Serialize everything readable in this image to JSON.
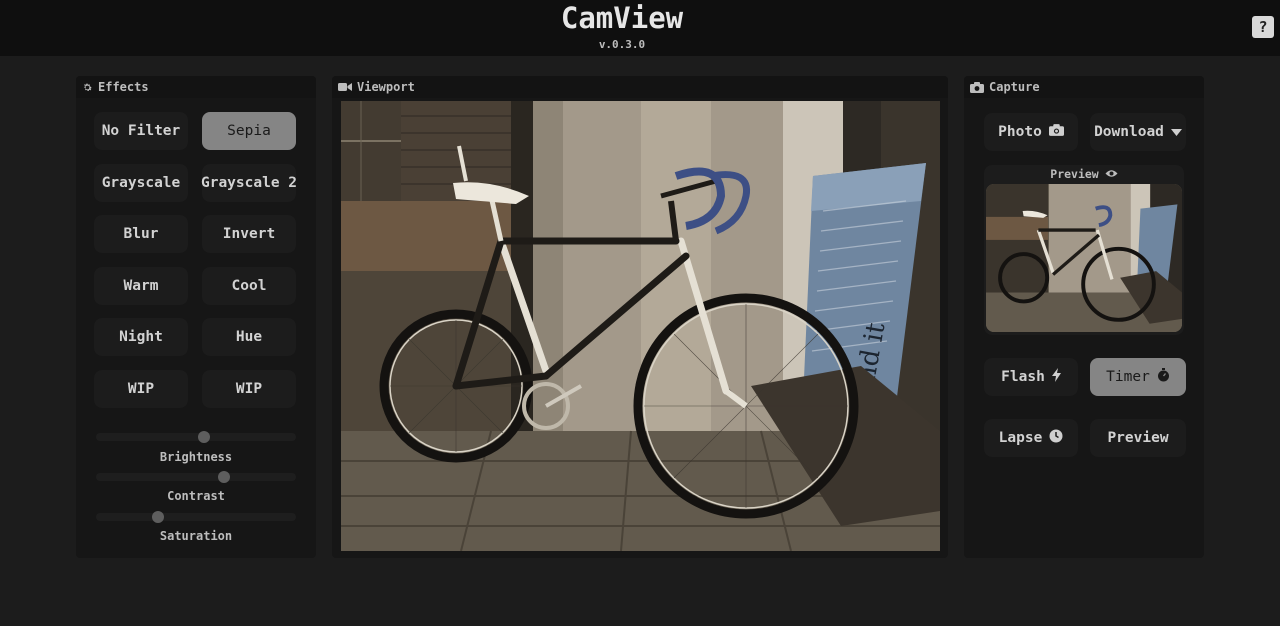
{
  "app": {
    "title": "CamView",
    "version": "v.0.3.0",
    "help_label": "?"
  },
  "effects": {
    "title": "Effects",
    "filters": [
      {
        "label": "No Filter",
        "active": false
      },
      {
        "label": "Sepia",
        "active": true
      },
      {
        "label": "Grayscale",
        "active": false
      },
      {
        "label": "Grayscale 2",
        "active": false
      },
      {
        "label": "Blur",
        "active": false
      },
      {
        "label": "Invert",
        "active": false
      },
      {
        "label": "Warm",
        "active": false
      },
      {
        "label": "Cool",
        "active": false
      },
      {
        "label": "Night",
        "active": false
      },
      {
        "label": "Hue",
        "active": false
      },
      {
        "label": "WIP",
        "active": false
      },
      {
        "label": "WIP",
        "active": false
      }
    ],
    "sliders": [
      {
        "label": "Brightness",
        "value": 0.54
      },
      {
        "label": "Contrast",
        "value": 0.64
      },
      {
        "label": "Saturation",
        "value": 0.31
      }
    ]
  },
  "viewport": {
    "title": "Viewport"
  },
  "capture": {
    "title": "Capture",
    "photo_label": "Photo",
    "download_label": "Download",
    "preview_title": "Preview",
    "flash_label": "Flash",
    "timer_label": "Timer",
    "lapse_label": "Lapse",
    "preview_button_label": "Preview"
  },
  "colors": {
    "background": "#1c1c1c",
    "header": "#0f0f0f",
    "panel": "#161616",
    "button": "#1c1c1c",
    "active_button": "#858585",
    "text": "#d2d2d2"
  },
  "icons": [
    "gear-icon",
    "video-camera-icon",
    "camera-icon",
    "chevron-down-icon",
    "eye-icon",
    "bolt-icon",
    "stopwatch-icon",
    "clock-icon"
  ]
}
